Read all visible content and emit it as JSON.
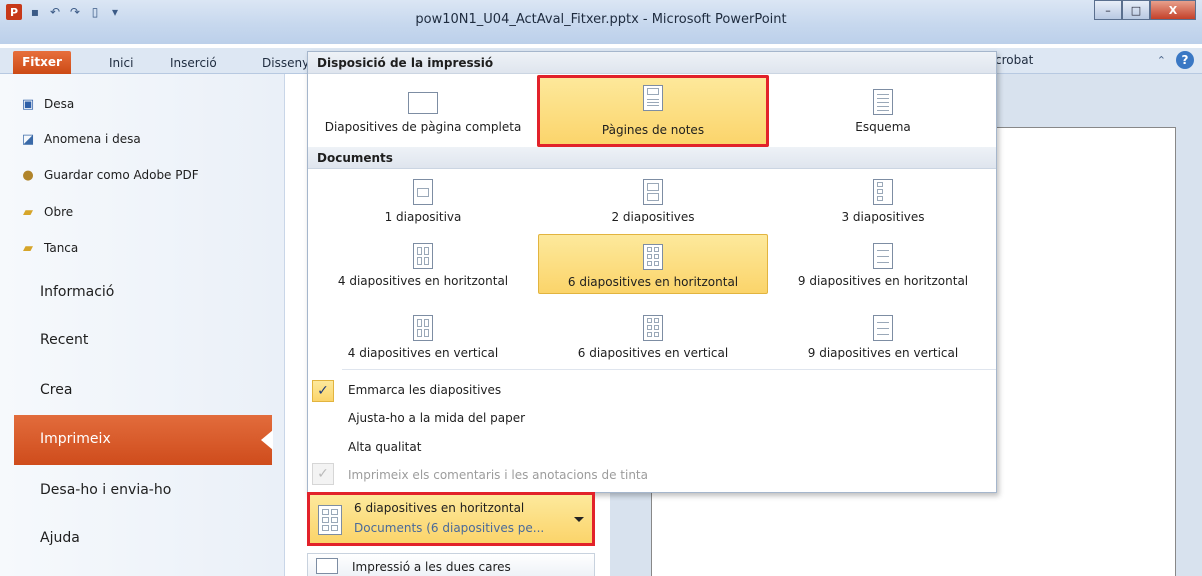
{
  "window": {
    "title": "pow10N1_U04_ActAval_Fitxer.pptx - Microsoft PowerPoint",
    "app_logo": "P",
    "minimize": "–",
    "maximize": "□",
    "close": "X"
  },
  "ribbon": {
    "tabs": [
      {
        "label": "Fitxer",
        "active": true
      },
      {
        "label": "Inici"
      },
      {
        "label": "Inserció"
      },
      {
        "label": "Disseny"
      }
    ],
    "partial_tab_right": "crobat",
    "help": "?"
  },
  "backstage": {
    "commands": [
      {
        "label": "Desa",
        "icon": "save-icon"
      },
      {
        "label": "Anomena i desa",
        "icon": "save-as-icon"
      },
      {
        "label": "Guardar como Adobe PDF",
        "icon": "pdf-icon"
      },
      {
        "label": "Obre",
        "icon": "open-folder-icon"
      },
      {
        "label": "Tanca",
        "icon": "close-folder-icon"
      }
    ],
    "sections": [
      {
        "label": "Informació"
      },
      {
        "label": "Recent"
      },
      {
        "label": "Crea"
      },
      {
        "label": "Imprimeix",
        "active": true
      },
      {
        "label": "Desa-ho i envia-ho"
      },
      {
        "label": "Ajuda"
      }
    ]
  },
  "gallery": {
    "layout_header": "Disposició de la impressió",
    "layout_items": [
      {
        "label": "Diapositives de pàgina completa"
      },
      {
        "label": "Pàgines de notes",
        "highlighted": true,
        "annotated": true
      },
      {
        "label": "Esquema"
      }
    ],
    "documents_header": "Documents",
    "document_items": [
      {
        "label": "1 diapositiva"
      },
      {
        "label": "2 diapositives"
      },
      {
        "label": "3 diapositives"
      },
      {
        "label": "4 diapositives en horitzontal"
      },
      {
        "label": "6 diapositives en horitzontal",
        "selected": true
      },
      {
        "label": "9 diapositives en horitzontal"
      },
      {
        "label": "4 diapositives en vertical"
      },
      {
        "label": "6 diapositives en vertical"
      },
      {
        "label": "9 diapositives en vertical"
      }
    ],
    "options": [
      {
        "label": "Emmarca les diapositives",
        "checked": true,
        "enabled": true
      },
      {
        "label": "Ajusta-ho a la mida del paper",
        "checked": false,
        "enabled": true
      },
      {
        "label": "Alta qualitat",
        "checked": false,
        "enabled": true
      },
      {
        "label": "Imprimeix els comentaris i les anotacions de tinta",
        "checked": true,
        "enabled": false
      }
    ],
    "check_glyph": "✓"
  },
  "settings": {
    "layout_selector": {
      "title": "6 diapositives en horitzontal",
      "subtitle": "Documents (6 diapositives pe..."
    },
    "duplex": {
      "label": "Impressió a les dues cares"
    }
  },
  "colors": {
    "file_tab": "#d0541c",
    "active_section": "#d65a26",
    "highlight": "#fbd46a",
    "annotation_red": "#e2222a"
  }
}
